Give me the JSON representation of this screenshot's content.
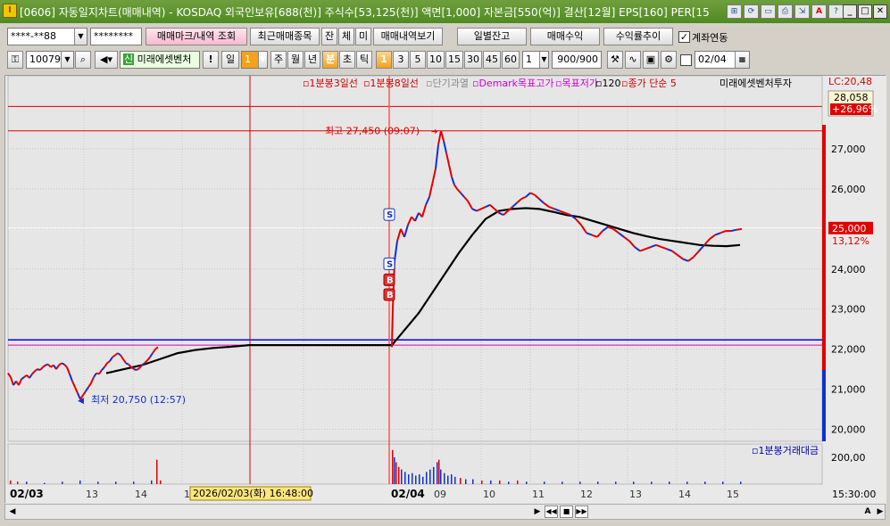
{
  "window": {
    "title": "[0606] 자동일지차트(매매내역) - KOSDAQ 외국인보유[688(천)] 주식수[53,125(천)] 액면[1,000] 자본금[550(억)] 결산[12월] EPS[160] PER[15",
    "app_icon": "I",
    "toolbar_icons": [
      "link-icon",
      "refresh-icon",
      "window-icon",
      "print-icon",
      "export-icon",
      "font-icon",
      "help-icon"
    ],
    "toolbar_glyphs": [
      "⊞",
      "⟳",
      "▭",
      "⎙",
      "⇲",
      "A",
      "?"
    ]
  },
  "controls": {
    "account_value": "****-**88",
    "password_value": "********",
    "trade_mark_button": "매매마크/내역 조회",
    "recent_trade_button": "최근매매종목",
    "filter_buttons": [
      "잔",
      "체",
      "미"
    ],
    "trade_history_button": "매매내역보기",
    "daily_balance_button": "일별잔고",
    "trade_profit_button": "매매수익",
    "return_trend_button": "수익률추이",
    "account_link_label": "계좌연동",
    "account_link_checked": "✓",
    "stock_code": "100790",
    "credit_badge": "신",
    "stock_name": "미래에셋벤처",
    "alert_mark": "!",
    "period_label": "일",
    "period_value": "1",
    "period_buttons": [
      "주",
      "월",
      "년",
      "분",
      "초",
      "틱"
    ],
    "interval_buttons": [
      "1",
      "3",
      "5",
      "10",
      "15",
      "30",
      "45",
      "60"
    ],
    "interval_value": "1",
    "count_value": "900/900",
    "date_value": "02/04"
  },
  "chart_data": {
    "type": "line",
    "legend": [
      "1분봉3일선",
      "1분봉8일선",
      "단기과열",
      "Demark목표고가",
      "목표저가",
      "120",
      "종가 단순 5",
      "미래에셋벤처투자"
    ],
    "legend_colors": [
      "#d00000",
      "#d00000",
      "#888888",
      "#d000d0",
      "#d000d0",
      "#000000",
      "#d00000",
      "#000000"
    ],
    "y_ticks": [
      "27,000",
      "26,000",
      "25,000",
      "24,000",
      "23,000",
      "22,000",
      "21,000",
      "20,000"
    ],
    "y_tick_values": [
      27000,
      26000,
      25000,
      24000,
      23000,
      22000,
      21000,
      20000
    ],
    "ylim": [
      19700,
      28200
    ],
    "x_ticks": [
      "02/03",
      "13",
      "14",
      "15",
      "8",
      "02/04",
      "09",
      "10",
      "11",
      "12",
      "13",
      "14",
      "15"
    ],
    "volume_label": "1분봉거래대금",
    "volume_tick": "200,00",
    "time_label": "15:30:00",
    "crosshair_time": "2026/02/03(화) 16:48:00",
    "high_annotation": "최고 27,450 (09:07)",
    "high_value": 27450,
    "low_annotation": "최저 20,750 (12:57)",
    "low_value": 20750,
    "current_price": "25,000",
    "current_change": "13,12%",
    "current_value": 25000,
    "upper_tag_price": "28,058",
    "upper_tag_change": "+26,96%",
    "lc_label": "LC:20,48",
    "trade_marks": [
      {
        "label": "S",
        "price": 25350
      },
      {
        "label": "S",
        "price": 24120
      },
      {
        "label": "B",
        "price": 23720
      },
      {
        "label": "B",
        "price": 23350
      }
    ],
    "hlines": [
      {
        "value": 27450,
        "color": "#e00000"
      },
      {
        "value": 28058,
        "color": "#e00000"
      },
      {
        "value": 22230,
        "color": "#0000ff"
      },
      {
        "value": 22100,
        "color": "#e000a0"
      },
      {
        "value": 25020,
        "color": "#ffffff"
      }
    ],
    "price_series": [
      [
        0,
        21400
      ],
      [
        3,
        21300
      ],
      [
        6,
        21100
      ],
      [
        9,
        21200
      ],
      [
        12,
        21100
      ],
      [
        15,
        21250
      ],
      [
        18,
        21300
      ],
      [
        21,
        21350
      ],
      [
        24,
        21280
      ],
      [
        27,
        21380
      ],
      [
        30,
        21450
      ],
      [
        33,
        21500
      ],
      [
        36,
        21480
      ],
      [
        39,
        21550
      ],
      [
        42,
        21600
      ],
      [
        45,
        21620
      ],
      [
        48,
        21550
      ],
      [
        51,
        21600
      ],
      [
        54,
        21500
      ],
      [
        57,
        21600
      ],
      [
        60,
        21650
      ],
      [
        63,
        21620
      ],
      [
        66,
        21550
      ],
      [
        69,
        21380
      ],
      [
        72,
        21200
      ],
      [
        75,
        21050
      ],
      [
        78,
        20900
      ],
      [
        81,
        20750
      ],
      [
        84,
        20850
      ],
      [
        87,
        20950
      ],
      [
        90,
        21050
      ],
      [
        93,
        21150
      ],
      [
        96,
        21300
      ],
      [
        99,
        21400
      ],
      [
        102,
        21380
      ],
      [
        105,
        21480
      ],
      [
        108,
        21550
      ],
      [
        111,
        21650
      ],
      [
        114,
        21700
      ],
      [
        117,
        21800
      ],
      [
        120,
        21850
      ],
      [
        123,
        21900
      ],
      [
        126,
        21850
      ],
      [
        129,
        21750
      ],
      [
        132,
        21650
      ],
      [
        135,
        21620
      ],
      [
        138,
        21550
      ],
      [
        141,
        21500
      ],
      [
        144,
        21480
      ],
      [
        147,
        21520
      ],
      [
        150,
        21600
      ],
      [
        153,
        21650
      ],
      [
        156,
        21720
      ],
      [
        159,
        21800
      ],
      [
        162,
        21900
      ],
      [
        165,
        22000
      ],
      [
        168,
        22050
      ],
      [
        430,
        22050
      ],
      [
        431,
        23000
      ],
      [
        433,
        24200
      ],
      [
        436,
        24700
      ],
      [
        440,
        25000
      ],
      [
        444,
        24800
      ],
      [
        448,
        25100
      ],
      [
        452,
        25300
      ],
      [
        456,
        25200
      ],
      [
        460,
        25400
      ],
      [
        464,
        25300
      ],
      [
        468,
        25600
      ],
      [
        472,
        25800
      ],
      [
        476,
        26200
      ],
      [
        479,
        26500
      ],
      [
        482,
        27100
      ],
      [
        485,
        27450
      ],
      [
        488,
        27200
      ],
      [
        491,
        26900
      ],
      [
        494,
        26600
      ],
      [
        497,
        26300
      ],
      [
        500,
        26100
      ],
      [
        503,
        26000
      ],
      [
        507,
        25900
      ],
      [
        511,
        25800
      ],
      [
        515,
        25700
      ],
      [
        520,
        25500
      ],
      [
        525,
        25450
      ],
      [
        530,
        25500
      ],
      [
        535,
        25550
      ],
      [
        540,
        25600
      ],
      [
        545,
        25500
      ],
      [
        550,
        25400
      ],
      [
        555,
        25350
      ],
      [
        560,
        25450
      ],
      [
        565,
        25550
      ],
      [
        570,
        25650
      ],
      [
        575,
        25750
      ],
      [
        580,
        25800
      ],
      [
        585,
        25900
      ],
      [
        590,
        25850
      ],
      [
        595,
        25750
      ],
      [
        600,
        25650
      ],
      [
        606,
        25550
      ],
      [
        612,
        25500
      ],
      [
        618,
        25450
      ],
      [
        624,
        25400
      ],
      [
        630,
        25350
      ],
      [
        636,
        25250
      ],
      [
        642,
        25100
      ],
      [
        648,
        24900
      ],
      [
        654,
        24850
      ],
      [
        660,
        24800
      ],
      [
        666,
        24950
      ],
      [
        672,
        25050
      ],
      [
        678,
        25000
      ],
      [
        684,
        24900
      ],
      [
        690,
        24800
      ],
      [
        696,
        24700
      ],
      [
        702,
        24550
      ],
      [
        708,
        24450
      ],
      [
        714,
        24500
      ],
      [
        720,
        24550
      ],
      [
        726,
        24600
      ],
      [
        732,
        24550
      ],
      [
        738,
        24500
      ],
      [
        744,
        24450
      ],
      [
        750,
        24350
      ],
      [
        756,
        24250
      ],
      [
        762,
        24200
      ],
      [
        768,
        24300
      ],
      [
        774,
        24450
      ],
      [
        780,
        24600
      ],
      [
        786,
        24750
      ],
      [
        792,
        24850
      ],
      [
        798,
        24900
      ],
      [
        804,
        24950
      ],
      [
        810,
        24950
      ],
      [
        816,
        24980
      ],
      [
        822,
        25000
      ]
    ],
    "ma_series": [
      [
        110,
        21400
      ],
      [
        130,
        21500
      ],
      [
        150,
        21600
      ],
      [
        170,
        21750
      ],
      [
        190,
        21900
      ],
      [
        210,
        21980
      ],
      [
        230,
        22030
      ],
      [
        250,
        22060
      ],
      [
        270,
        22100
      ],
      [
        290,
        22100
      ],
      [
        430,
        22100
      ],
      [
        445,
        22500
      ],
      [
        460,
        22900
      ],
      [
        475,
        23400
      ],
      [
        490,
        23900
      ],
      [
        505,
        24400
      ],
      [
        520,
        24850
      ],
      [
        535,
        25250
      ],
      [
        550,
        25450
      ],
      [
        565,
        25500
      ],
      [
        580,
        25520
      ],
      [
        595,
        25500
      ],
      [
        610,
        25430
      ],
      [
        625,
        25350
      ],
      [
        640,
        25300
      ],
      [
        655,
        25200
      ],
      [
        670,
        25100
      ],
      [
        685,
        25000
      ],
      [
        700,
        24900
      ],
      [
        715,
        24820
      ],
      [
        730,
        24750
      ],
      [
        745,
        24700
      ],
      [
        760,
        24650
      ],
      [
        775,
        24600
      ],
      [
        790,
        24580
      ],
      [
        805,
        24570
      ],
      [
        820,
        24600
      ]
    ],
    "volume_series": [
      [
        2,
        3
      ],
      [
        10,
        2
      ],
      [
        20,
        2
      ],
      [
        40,
        1
      ],
      [
        60,
        2
      ],
      [
        80,
        3
      ],
      [
        100,
        2
      ],
      [
        120,
        2
      ],
      [
        140,
        2
      ],
      [
        160,
        3
      ],
      [
        166,
        20
      ],
      [
        170,
        3
      ],
      [
        430,
        28
      ],
      [
        432,
        22
      ],
      [
        434,
        18
      ],
      [
        437,
        14
      ],
      [
        440,
        12
      ],
      [
        444,
        10
      ],
      [
        448,
        8
      ],
      [
        452,
        9
      ],
      [
        456,
        7
      ],
      [
        460,
        8
      ],
      [
        464,
        6
      ],
      [
        468,
        10
      ],
      [
        472,
        12
      ],
      [
        476,
        14
      ],
      [
        480,
        18
      ],
      [
        482,
        20
      ],
      [
        484,
        12
      ],
      [
        488,
        9
      ],
      [
        492,
        7
      ],
      [
        496,
        8
      ],
      [
        500,
        6
      ],
      [
        506,
        5
      ],
      [
        512,
        4
      ],
      [
        520,
        4
      ],
      [
        530,
        3
      ],
      [
        540,
        3
      ],
      [
        550,
        3
      ],
      [
        560,
        2
      ],
      [
        570,
        3
      ],
      [
        580,
        2
      ],
      [
        600,
        2
      ],
      [
        620,
        2
      ],
      [
        640,
        2
      ],
      [
        660,
        2
      ],
      [
        680,
        2
      ],
      [
        700,
        2
      ],
      [
        720,
        2
      ],
      [
        740,
        2
      ],
      [
        760,
        2
      ],
      [
        780,
        2
      ],
      [
        800,
        2
      ],
      [
        820,
        2
      ]
    ]
  }
}
